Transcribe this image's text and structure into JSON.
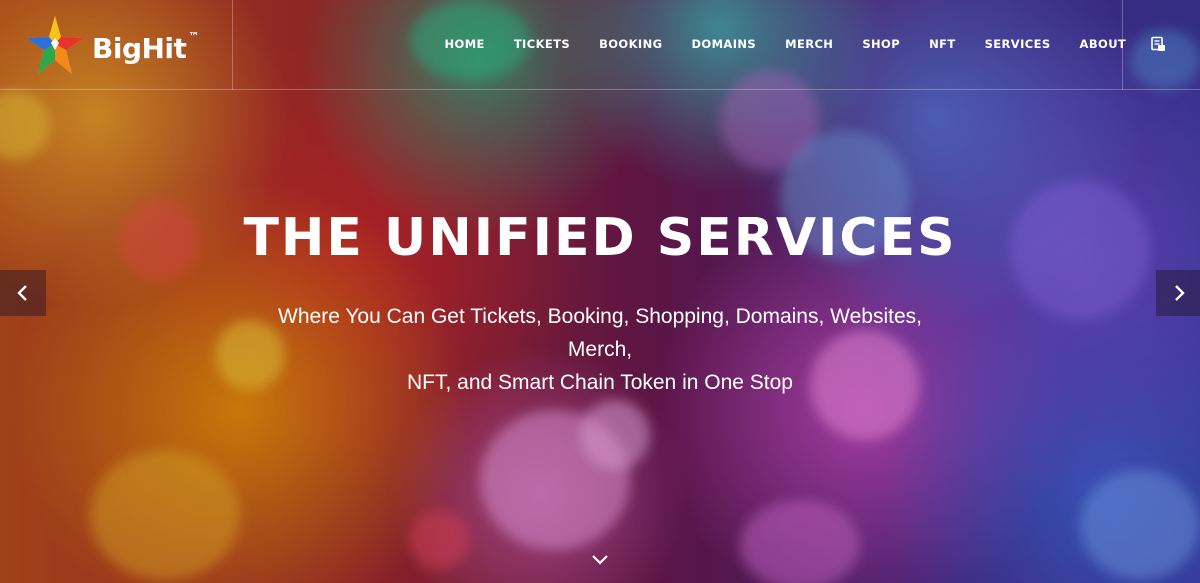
{
  "brand": {
    "name": "BigHit",
    "trademark": "™"
  },
  "nav": {
    "items": [
      {
        "label": "HOME"
      },
      {
        "label": "TICKETS"
      },
      {
        "label": "BOOKING"
      },
      {
        "label": "DOMAINS"
      },
      {
        "label": "MERCH"
      },
      {
        "label": "SHOP"
      },
      {
        "label": "NFT"
      },
      {
        "label": "SERVICES"
      },
      {
        "label": "ABOUT"
      }
    ],
    "cart_icon": "cart-icon"
  },
  "hero": {
    "headline": "THE UNIFIED SERVICES",
    "subline_1": "Where You Can Get Tickets, Booking, Shopping, Domains, Websites, Merch,",
    "subline_2": "NFT, and Smart Chain Token in One Stop",
    "prev_icon": "chevron-left-icon",
    "next_icon": "chevron-right-icon",
    "scroll_icon": "chevron-down-icon"
  },
  "colors": {
    "text": "#ffffff",
    "arrow_bg": "rgba(30,20,40,0.45)",
    "star_red": "#e8322c",
    "star_yellow": "#f6c21c",
    "star_blue": "#2d6fd6",
    "star_green": "#2da84a",
    "star_orange": "#f28a1b"
  }
}
